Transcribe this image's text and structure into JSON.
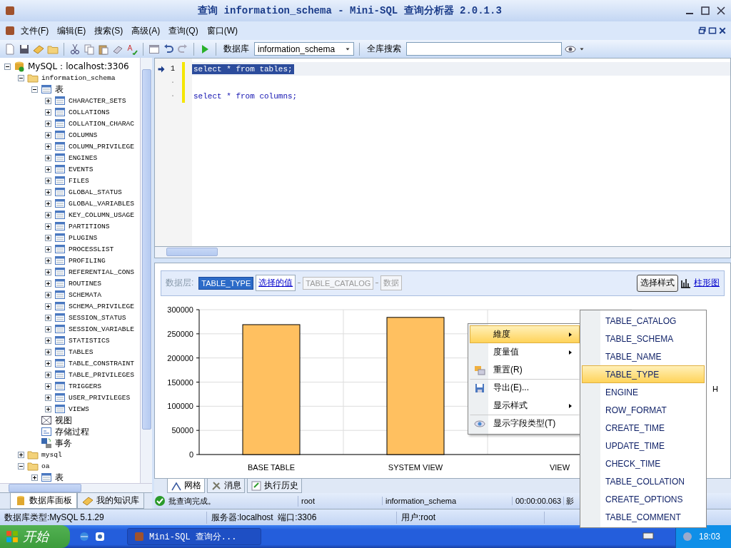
{
  "window": {
    "title": "查询 information_schema - Mini-SQL 查询分析器 2.0.1.3"
  },
  "menu": [
    {
      "label": "文件(F)"
    },
    {
      "label": "编辑(E)"
    },
    {
      "label": "搜索(S)"
    },
    {
      "label": "高级(A)"
    },
    {
      "label": "查询(Q)"
    },
    {
      "label": "窗口(W)"
    }
  ],
  "toolbar": {
    "database_label": "数据库",
    "database_value": "information_schema",
    "search_label": "全库搜索"
  },
  "tree": [
    {
      "label": "MySQL：localhost:3306",
      "kind": "server",
      "expanded": true,
      "children": [
        {
          "label": "information_schema",
          "kind": "folder",
          "expanded": true,
          "children": [
            {
              "label": "表",
              "kind": "group",
              "expanded": true,
              "children": [
                {
                  "label": "CHARACTER_SETS",
                  "kind": "table",
                  "expanded": false
                },
                {
                  "label": "COLLATIONS",
                  "kind": "table",
                  "expanded": false
                },
                {
                  "label": "COLLATION_CHARAC",
                  "kind": "table",
                  "expanded": false
                },
                {
                  "label": "COLUMNS",
                  "kind": "table",
                  "expanded": false
                },
                {
                  "label": "COLUMN_PRIVILEGE",
                  "kind": "table",
                  "expanded": false
                },
                {
                  "label": "ENGINES",
                  "kind": "table",
                  "expanded": false
                },
                {
                  "label": "EVENTS",
                  "kind": "table",
                  "expanded": false
                },
                {
                  "label": "FILES",
                  "kind": "table",
                  "expanded": false
                },
                {
                  "label": "GLOBAL_STATUS",
                  "kind": "table",
                  "expanded": false
                },
                {
                  "label": "GLOBAL_VARIABLES",
                  "kind": "table",
                  "expanded": false
                },
                {
                  "label": "KEY_COLUMN_USAGE",
                  "kind": "table",
                  "expanded": false
                },
                {
                  "label": "PARTITIONS",
                  "kind": "table",
                  "expanded": false
                },
                {
                  "label": "PLUGINS",
                  "kind": "table",
                  "expanded": false
                },
                {
                  "label": "PROCESSLIST",
                  "kind": "table",
                  "expanded": false
                },
                {
                  "label": "PROFILING",
                  "kind": "table",
                  "expanded": false
                },
                {
                  "label": "REFERENTIAL_CONS",
                  "kind": "table",
                  "expanded": false
                },
                {
                  "label": "ROUTINES",
                  "kind": "table",
                  "expanded": false
                },
                {
                  "label": "SCHEMATA",
                  "kind": "table",
                  "expanded": false
                },
                {
                  "label": "SCHEMA_PRIVILEGE",
                  "kind": "table",
                  "expanded": false
                },
                {
                  "label": "SESSION_STATUS",
                  "kind": "table",
                  "expanded": false
                },
                {
                  "label": "SESSION_VARIABLE",
                  "kind": "table",
                  "expanded": false
                },
                {
                  "label": "STATISTICS",
                  "kind": "table",
                  "expanded": false
                },
                {
                  "label": "TABLES",
                  "kind": "table",
                  "expanded": false
                },
                {
                  "label": "TABLE_CONSTRAINT",
                  "kind": "table",
                  "expanded": false
                },
                {
                  "label": "TABLE_PRIVILEGES",
                  "kind": "table",
                  "expanded": false
                },
                {
                  "label": "TRIGGERS",
                  "kind": "table",
                  "expanded": false
                },
                {
                  "label": "USER_PRIVILEGES",
                  "kind": "table",
                  "expanded": false
                },
                {
                  "label": "VIEWS",
                  "kind": "table",
                  "expanded": false
                }
              ]
            },
            {
              "label": "视图",
              "kind": "view"
            },
            {
              "label": "存储过程",
              "kind": "procedure"
            },
            {
              "label": "事务",
              "kind": "transaction"
            }
          ]
        },
        {
          "label": "mysql",
          "kind": "folder",
          "expanded": false
        },
        {
          "label": "oa",
          "kind": "folder",
          "expanded": true,
          "children": [
            {
              "label": "表",
              "kind": "group",
              "expanded": false
            }
          ]
        }
      ]
    }
  ],
  "left_tabs": [
    {
      "label": "数据库面板",
      "selected": true
    },
    {
      "label": "我的知识库",
      "selected": false
    }
  ],
  "editor": {
    "lines": [
      {
        "number": "1",
        "text": "select * from tables;",
        "selected": true
      },
      {
        "number": "·",
        "selected": false
      },
      {
        "number": "·",
        "text": "select * from columns;",
        "selected": false
      }
    ]
  },
  "results": {
    "layer_label": "数据层:",
    "breadcrumbs": [
      {
        "label": "TABLE_TYPE",
        "kind": "active"
      },
      {
        "label": "选择的值",
        "kind": "link"
      },
      {
        "label": "TABLE_CATALOG",
        "kind": "disabled"
      },
      {
        "label": "数据",
        "kind": "disabled"
      }
    ],
    "style_button": "选择样式",
    "chart_link": "柱形图",
    "legend_fragment": "H",
    "chart_data": {
      "type": "bar",
      "grid": true,
      "categories": [
        "BASE TABLE",
        "SYSTEM VIEW",
        "VIEW"
      ],
      "series": [
        {
          "color": "#ffc060",
          "values": [
            269000,
            284000,
            0
          ]
        }
      ],
      "ylim": [
        0,
        300000
      ],
      "yticks": [
        0,
        50000,
        100000,
        150000,
        200000,
        250000,
        300000
      ]
    }
  },
  "result_tabs": [
    {
      "label": "网格",
      "selected": true
    },
    {
      "label": "消息",
      "selected": false
    },
    {
      "label": "执行历史",
      "selected": false
    }
  ],
  "query_status": {
    "message": "批查询完成。",
    "user": "root",
    "database": "information_schema",
    "elapsed": "00:00:00.063",
    "fragment": "影"
  },
  "status_bar": [
    "数据库类型:MySQL 5.1.29",
    "服务器:localhost  端口:3306",
    "用户:root"
  ],
  "context_menu": [
    {
      "label": "維度",
      "kind": "submenu",
      "highlighted": true,
      "separator_before": false
    },
    {
      "label": "度量值",
      "kind": "submenu",
      "highlighted": false,
      "separator_before": false
    },
    {
      "label": "重置(R)",
      "kind": "reset",
      "highlighted": false,
      "separator_before": false
    },
    {
      "label": "导出(E)...",
      "kind": "export",
      "highlighted": false,
      "separator_before": true
    },
    {
      "label": "显示样式",
      "kind": "submenu",
      "highlighted": false,
      "separator_before": false
    },
    {
      "label": "显示字段类型(T)",
      "kind": "toggle",
      "highlighted": false,
      "separator_before": true
    }
  ],
  "submenu": [
    {
      "label": "TABLE_CATALOG",
      "selected": false
    },
    {
      "label": "TABLE_SCHEMA",
      "selected": false
    },
    {
      "label": "TABLE_NAME",
      "selected": false
    },
    {
      "label": "TABLE_TYPE",
      "selected": true
    },
    {
      "label": "ENGINE",
      "selected": false
    },
    {
      "label": "ROW_FORMAT",
      "selected": false
    },
    {
      "label": "CREATE_TIME",
      "selected": false
    },
    {
      "label": "UPDATE_TIME",
      "selected": false
    },
    {
      "label": "CHECK_TIME",
      "selected": false
    },
    {
      "label": "TABLE_COLLATION",
      "selected": false
    },
    {
      "label": "CREATE_OPTIONS",
      "selected": false
    },
    {
      "label": "TABLE_COMMENT",
      "selected": false
    }
  ],
  "taskbar": {
    "start": "开始",
    "tasks": [
      {
        "label": "Mini-SQL 查询分...",
        "selected": true
      }
    ],
    "clock": "18:03"
  }
}
